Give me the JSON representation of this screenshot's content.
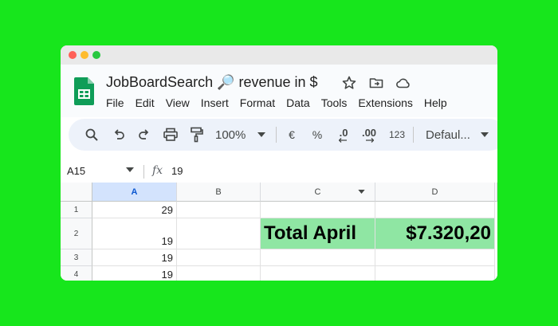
{
  "window": {
    "title": "JobBoardSearch 🔎 revenue in $",
    "menu": [
      "File",
      "Edit",
      "View",
      "Insert",
      "Format",
      "Data",
      "Tools",
      "Extensions",
      "Help"
    ]
  },
  "toolbar": {
    "zoom": "100%",
    "currency": "€",
    "percent": "%",
    "decrease_decimals": ".0",
    "increase_decimals": ".00",
    "number_format": "123",
    "font": "Defaul..."
  },
  "formula_bar": {
    "cell_ref": "A15",
    "fx": "fx",
    "value": "19"
  },
  "columns": [
    "A",
    "B",
    "C",
    "D"
  ],
  "rows": [
    {
      "num": "1",
      "a": "29",
      "c": "",
      "d": ""
    },
    {
      "num": "2",
      "a": "19",
      "c": "Total April",
      "d": "$7.320,20"
    },
    {
      "num": "3",
      "a": "19",
      "c": "",
      "d": ""
    },
    {
      "num": "4",
      "a": "19",
      "c": "",
      "d": ""
    }
  ],
  "colors": {
    "background": "#17e61c",
    "highlight": "#8fe6a3",
    "selected_column": "#d3e3fd",
    "sheets_green": "#0f9d58"
  }
}
